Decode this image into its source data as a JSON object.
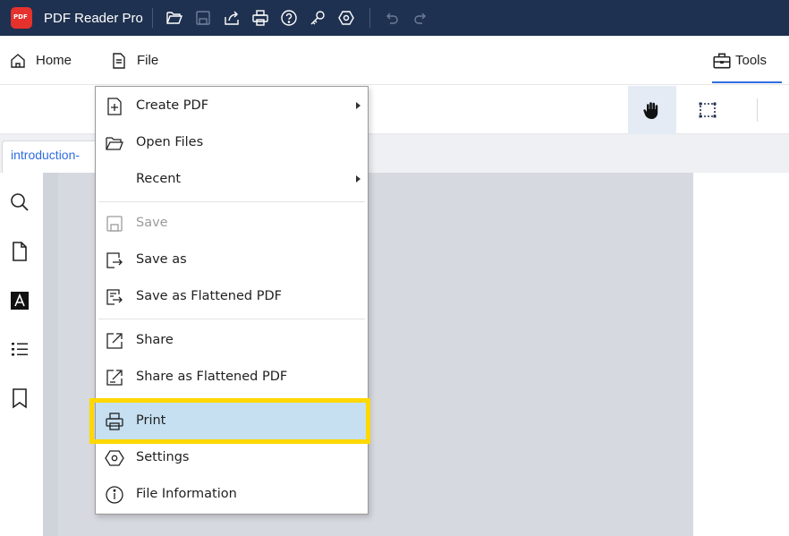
{
  "window": {
    "app_title": "PDF Reader Pro",
    "logo_text": "PDF",
    "titlebar_icons": [
      "open-folder-icon",
      "save-icon",
      "share-icon",
      "print-icon",
      "help-icon",
      "key-icon",
      "settings-icon",
      "undo-icon",
      "redo-icon"
    ]
  },
  "menubar": {
    "home_label": "Home",
    "file_label": "File",
    "tools_label": "Tools"
  },
  "tab": {
    "label": "introduction-"
  },
  "file_menu": {
    "items": [
      {
        "label": "Create PDF",
        "icon": "create-pdf-icon",
        "submenu": true
      },
      {
        "label": "Open Files",
        "icon": "open-folder-icon"
      },
      {
        "label": "Recent",
        "icon": "",
        "submenu": true
      },
      {
        "label": "Save",
        "icon": "save-icon",
        "disabled": true
      },
      {
        "label": "Save as",
        "icon": "save-as-icon"
      },
      {
        "label": "Save as Flattened PDF",
        "icon": "save-flattened-icon"
      },
      {
        "label": "Share",
        "icon": "share-icon"
      },
      {
        "label": "Share as Flattened PDF",
        "icon": "share-flattened-icon"
      },
      {
        "label": "Print",
        "icon": "print-icon",
        "active": true
      },
      {
        "label": "Settings",
        "icon": "settings-icon"
      },
      {
        "label": "File Information",
        "icon": "info-icon"
      }
    ]
  },
  "colors": {
    "titlebar": "#1f3150",
    "accent": "#2f6de1",
    "highlight_box": "#ffd800",
    "active_item": "#c6e0f2"
  }
}
